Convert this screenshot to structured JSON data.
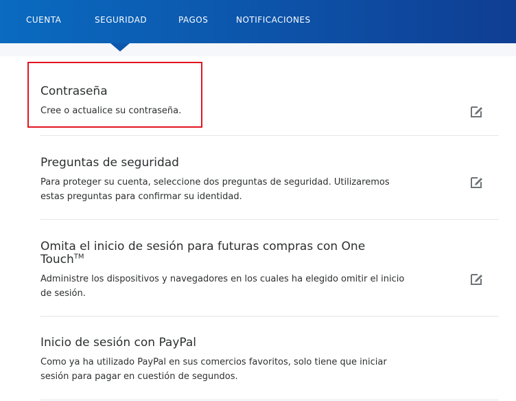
{
  "nav": {
    "tabs": [
      {
        "label": "CUENTA"
      },
      {
        "label": "SEGURIDAD"
      },
      {
        "label": "PAGOS"
      },
      {
        "label": "NOTIFICACIONES"
      }
    ],
    "active_tab": "SEGURIDAD"
  },
  "sections": [
    {
      "title": "Contraseña",
      "description": "Cree o actualice su contraseña.",
      "edit_icon": "edit-icon"
    },
    {
      "title": "Preguntas de seguridad",
      "description": "Para proteger su cuenta, seleccione dos preguntas de seguridad. Utilizaremos estas preguntas para confirmar su identidad.",
      "edit_icon": "edit-icon"
    },
    {
      "title_line1": "Omita el inicio de sesión para futuras compras con One",
      "title_line2": "Touch",
      "title_sup": "TM",
      "description": "Administre los dispositivos y navegadores en los cuales ha elegido omitir el inicio de sesión.",
      "edit_icon": "edit-icon"
    },
    {
      "title": "Inicio de sesión con PayPal",
      "description": "Como ya ha utilizado PayPal en sus comercios favoritos, solo tiene que iniciar sesión para pagar en cuestión de segundos."
    }
  ],
  "colors": {
    "nav_bg_start": "#0a6bc0",
    "nav_bg_end": "#0f3e93",
    "highlight_border": "#e2141e",
    "divider": "#e2e5e8",
    "icon": "#6c7378"
  }
}
